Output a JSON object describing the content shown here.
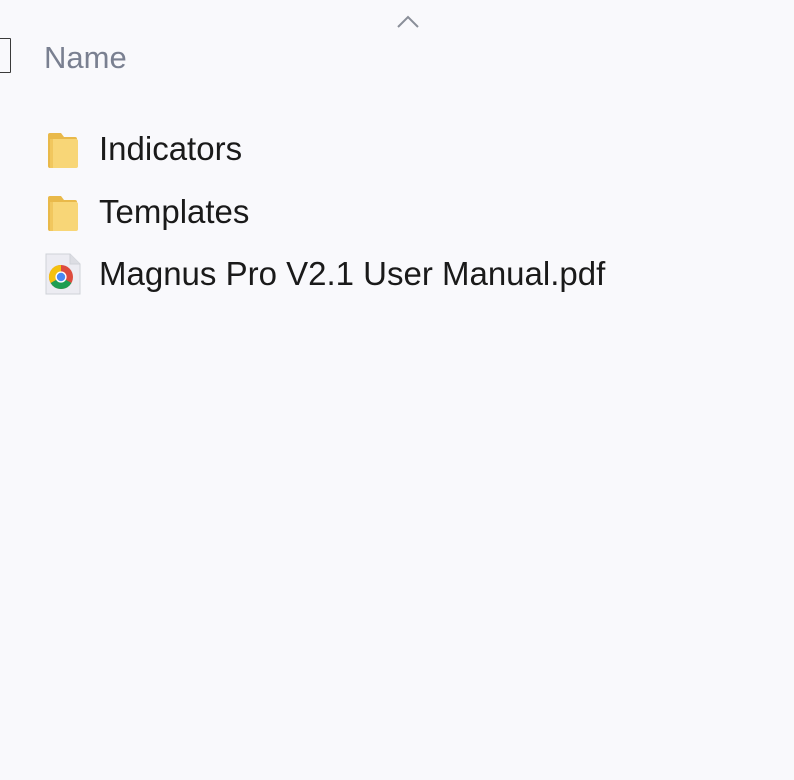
{
  "header": {
    "name_label": "Name",
    "sort_direction": "ascending"
  },
  "files": [
    {
      "name": "Indicators",
      "type": "folder",
      "icon": "folder-icon"
    },
    {
      "name": "Templates",
      "type": "folder",
      "icon": "folder-icon"
    },
    {
      "name": "Magnus Pro V2.1 User Manual.pdf",
      "type": "pdf",
      "icon": "chrome-pdf-icon"
    }
  ],
  "colors": {
    "background": "#f9f9fc",
    "header_text": "#7a8091",
    "item_text": "#1a1a1a",
    "folder": "#f6cf6a"
  }
}
